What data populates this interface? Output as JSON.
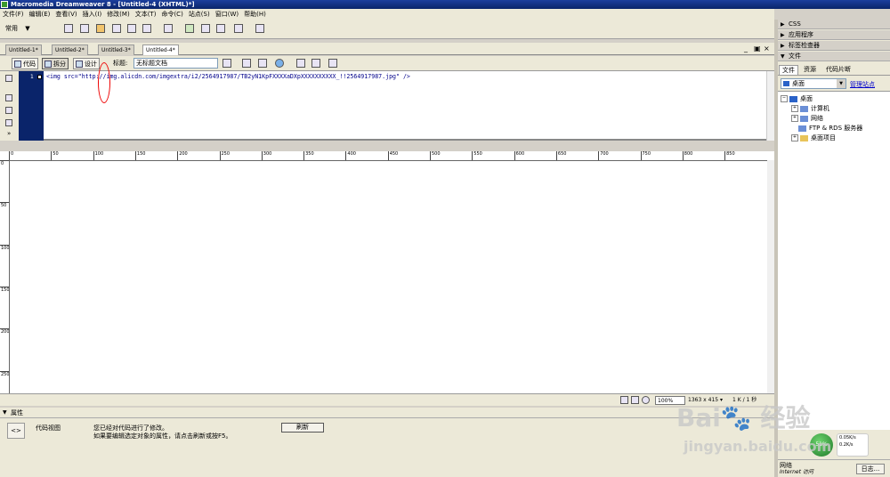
{
  "window": {
    "title": "Macromedia Dreamweaver 8 - [Untitled-4 (XHTML)*]"
  },
  "menu": [
    "文件(F)",
    "编辑(E)",
    "查看(V)",
    "插入(I)",
    "修改(M)",
    "文本(T)",
    "命令(C)",
    "站点(S)",
    "窗口(W)",
    "帮助(H)"
  ],
  "insert_bar": {
    "category": "常用",
    "dropdown": "▼"
  },
  "doc_tabs": [
    "Untitled-1*",
    "Untitled-2*",
    "Untitled-3*",
    "Untitled-4*"
  ],
  "window_controls": {
    "minimize": "_",
    "restore": "▣",
    "close": "×"
  },
  "doc_toolbar": {
    "code": "代码",
    "split": "拆分",
    "design": "设计",
    "title_label": "标题:",
    "title_value": "无标题文档"
  },
  "code": {
    "line_number": "1",
    "fold": "−",
    "line": "<img src=\"http://img.alicdn.com/imgextra/i2/2564917987/TB2yN1KpFXXXXaDXpXXXXXXXXXX_!!2564917987.jpg\" />"
  },
  "ruler": {
    "h": [
      "0",
      "50",
      "100",
      "150",
      "200",
      "250",
      "300",
      "350",
      "400",
      "450",
      "500",
      "550",
      "600",
      "650",
      "700",
      "750",
      "800",
      "850"
    ],
    "v": [
      "0",
      "50",
      "100",
      "150",
      "200",
      "250"
    ]
  },
  "status": {
    "zoom": "100%",
    "window_size": "1363 x 415 ▾",
    "file_size": "1 K / 1 秒"
  },
  "properties": {
    "title": "属性",
    "code_view_icon": "<>",
    "code_view_label": "代码视图",
    "msg1": "您已经对代码进行了修改。",
    "msg2": "如果要编辑选定对象的属性，请点击刷新或按F5。",
    "refresh": "刷新"
  },
  "right_panel": {
    "groups": [
      "CSS",
      "应用程序",
      "标签检查器",
      "文件"
    ],
    "file_tabs": [
      "文件",
      "资源",
      "代码片断"
    ],
    "site": "桌面",
    "manage_site": "管理站点",
    "tree": [
      {
        "label": "桌面",
        "indent": 0,
        "expander": "−"
      },
      {
        "label": "计算机",
        "indent": 1,
        "expander": "+"
      },
      {
        "label": "网络",
        "indent": 1,
        "expander": "+"
      },
      {
        "label": "FTP & RDS 服务器",
        "indent": 1,
        "expander": ""
      },
      {
        "label": "桌面项目",
        "indent": 1,
        "expander": "+"
      }
    ]
  },
  "tray": {
    "percent": "51%",
    "up": "0.05K/s",
    "down": "0.2K/s",
    "net_label": "网络",
    "net_sub": "Internet 访问",
    "log_button": "日志..."
  },
  "watermark": {
    "line1": "Bai🐾 经验",
    "line2": "jingyan.baidu.com"
  },
  "colors": {
    "title_bar": "#0a246a",
    "line_gutter": "#0a246a",
    "code_text": "#00008b",
    "annotation": "#e00000"
  }
}
